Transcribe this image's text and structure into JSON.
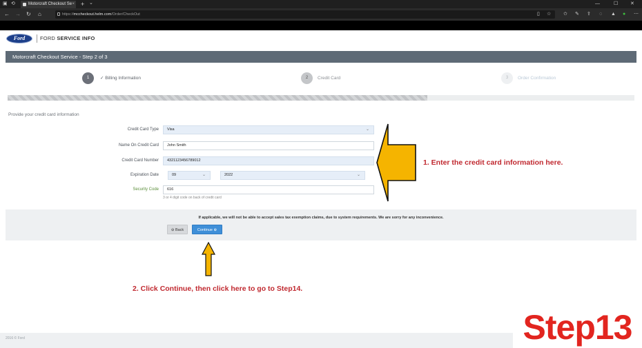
{
  "browser": {
    "tab_title": "Motorcraft Checkout Se",
    "tab_close": "×",
    "new_tab": "+",
    "tab_dropdown": "⌄",
    "url_prefix": "https://",
    "url_host": "mccheckout.helm.com",
    "url_path": "/Order/CheckOut",
    "window_min": "—",
    "window_max": "☐",
    "window_close": "✕"
  },
  "header": {
    "logo_text": "Ford",
    "brand_light": "FORD ",
    "brand_bold": "SERVICE INFO"
  },
  "page": {
    "title": "Motorcraft Checkout Service - Step 2 of 3"
  },
  "steps": [
    {
      "number": "1",
      "check": "✓",
      "label": "Billing Information",
      "state": "done"
    },
    {
      "number": "2",
      "label": "Credit Card",
      "state": "current"
    },
    {
      "number": "3",
      "label": "Order Confirmation",
      "state": "upcoming"
    }
  ],
  "progress": {
    "fraction": 0.67
  },
  "form": {
    "intro": "Provide your credit card information",
    "card_type": {
      "label": "Credit Card Type",
      "value": "Visa"
    },
    "name": {
      "label": "Name On Credit Card",
      "value": "John Smith"
    },
    "number": {
      "label": "Credit Card Number",
      "value": "4321123456789012"
    },
    "expiration": {
      "label": "Expiration Date",
      "month": "09",
      "year": "2022"
    },
    "security": {
      "label": "Security Code",
      "value": "616",
      "hint": "3 or 4 digit code on back of credit card"
    }
  },
  "notice": "If applicable, we will not be able to accept sales tax exemption claims, due to system requirements. We are sorry for any inconvenience.",
  "buttons": {
    "back": "Back",
    "back_icon": "⊖",
    "continue": "Continue",
    "continue_icon": "⊕"
  },
  "annotations": {
    "instruction_1": "1. Enter the credit card information here.",
    "instruction_2": "2. Click Continue, then click here to go to Step14.",
    "step_label": "Step13"
  },
  "footer": {
    "copyright": "2016 © Ford"
  },
  "colors": {
    "arrow_fill": "#f5b400",
    "annotation_red": "#c0282f",
    "step_red": "#e2251f",
    "continue_blue": "#3f8fd8"
  }
}
